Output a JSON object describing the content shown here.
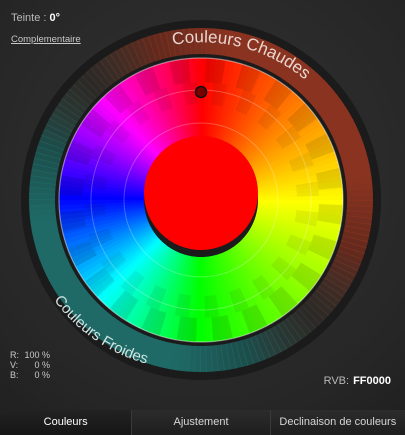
{
  "hue": {
    "label": "Teinte :",
    "value": "0°"
  },
  "complement_link": "Complementaire",
  "ring": {
    "warm_label": "Couleurs Chaudes",
    "cool_label": "Couleurs Froides"
  },
  "selected": {
    "color": "#FF0000",
    "hue_degrees": 0
  },
  "rgb_pct": [
    {
      "key": "R:",
      "value": "100 %"
    },
    {
      "key": "V:",
      "value": "0 %"
    },
    {
      "key": "B:",
      "value": "0 %"
    }
  ],
  "hex": {
    "label": "RVB:",
    "value": "FF0000"
  },
  "tabs": [
    {
      "label": "Couleurs",
      "active": true
    },
    {
      "label": "Ajustement",
      "active": false
    },
    {
      "label": "Declinaison de couleurs",
      "active": false
    }
  ],
  "colors": {
    "warm_ring": "#8a3320",
    "cool_ring": "#1f6a66",
    "background": "#2b2b2b"
  }
}
